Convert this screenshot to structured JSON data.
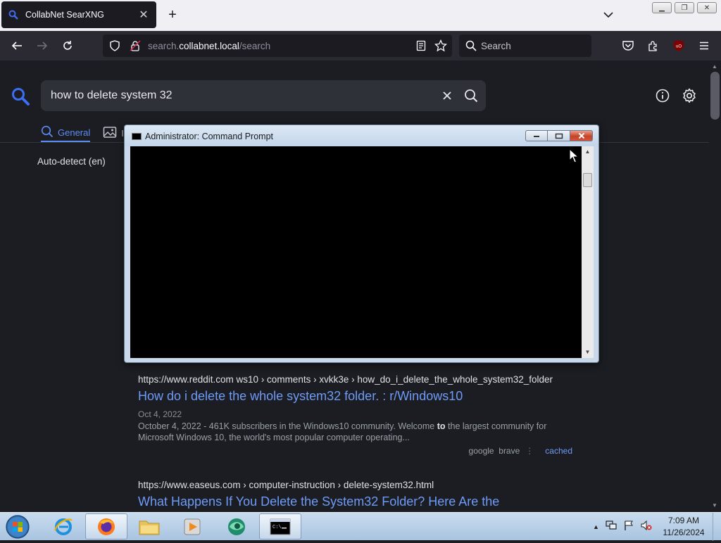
{
  "browser": {
    "tab_title": "CollabNet SearXNG",
    "url_prefix": "search.",
    "url_domain": "collabnet.local",
    "url_path": "/search",
    "searchbar_placeholder": "Search"
  },
  "searx": {
    "query": "how to delete system 32",
    "categories": [
      {
        "label": "General",
        "active": true
      },
      {
        "label": "Images",
        "visible_text": "In",
        "active": false
      }
    ],
    "language": "Auto-detect (en)"
  },
  "results": [
    {
      "url": "https://www.reddit.com ›windows10 › comments › xvkk3e › how_do_i_delete_the_whole_system32_folder",
      "url_visible": "https://www.reddit.com  ws10 › comments › xvkk3e › how_do_i_delete_the_whole_system32_folder",
      "title": "How do i delete the whole system32 folder. : r/Windows10",
      "date": "Oct 4, 2022",
      "snippet_pre": "October 4, 2022 - 461K subscribers in the Windows10 community. Welcome ",
      "snippet_bold": "to",
      "snippet_post": " the largest community for Microsoft Windows 10, the world's most popular computer operating...",
      "engines": [
        "google",
        "brave"
      ],
      "cached": "cached"
    },
    {
      "url": "https://www.easeus.com  › computer-instruction › delete-system32.html",
      "title": "What Happens If You Delete the System32 Folder? Here Are the"
    }
  ],
  "cmd_window": {
    "title": "Administrator:  Command Prompt"
  },
  "taskbar": {
    "time": "7:09 AM",
    "date": "11/26/2024",
    "apps": [
      "start-orb",
      "internet-explorer",
      "firefox",
      "file-explorer",
      "media-player",
      "app-green",
      "command-prompt"
    ]
  }
}
